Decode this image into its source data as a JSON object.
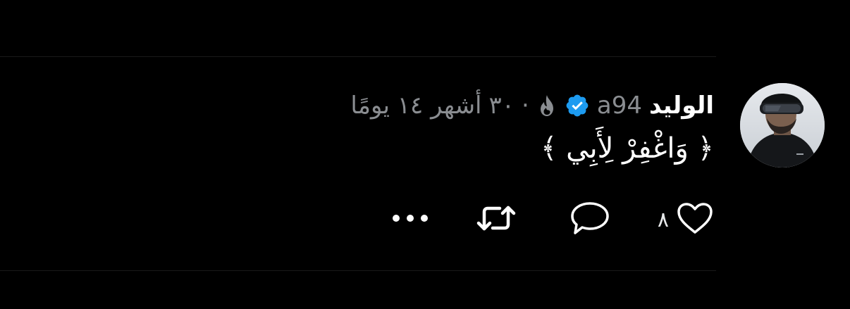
{
  "tweet": {
    "display_name": "الوليد",
    "handle": "a94",
    "separator": "·",
    "streak_count": "٣٠",
    "time_ago": "أشهر ١٤ يومًا",
    "text": "﴿ وَاغْفِرْ لِأَبِي ﴾",
    "verified": true,
    "verified_color": "#1d9bf0"
  },
  "actions": {
    "like_count": "٨",
    "icons": [
      "heart-icon",
      "reply-icon",
      "retweet-icon",
      "more-icon"
    ]
  },
  "colors": {
    "background": "#000000",
    "primary_text": "#ffffff",
    "secondary_text": "#8a8d91",
    "divider": "#1a1a1a"
  }
}
